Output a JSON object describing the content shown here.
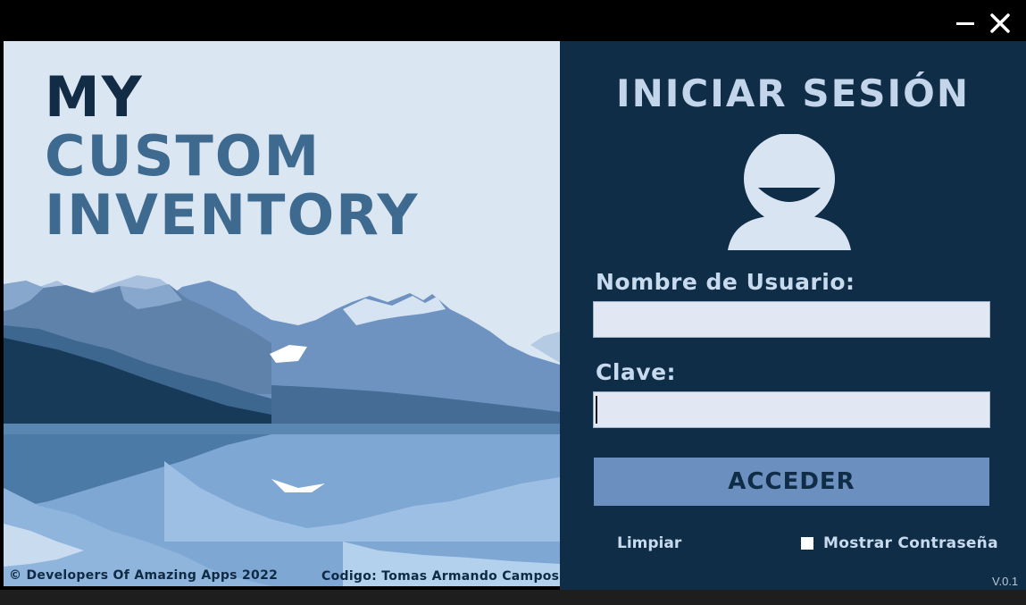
{
  "window": {
    "minimize_icon": "minimize-icon",
    "close_icon": "close-icon"
  },
  "brand": {
    "line1": "MY",
    "line2": "CUSTOM",
    "line3": "INVENTORY"
  },
  "footer": {
    "copyright": "© Developers Of Amazing Apps 2022",
    "credit": "Codigo: Tomas Armando Campos"
  },
  "login": {
    "title": "INICIAR SESIÓN",
    "avatar_icon": "user-avatar-icon",
    "username_label": "Nombre de Usuario:",
    "username_value": "",
    "password_label": "Clave:",
    "password_value": "",
    "submit_label": "ACCEDER",
    "clear_label": "Limpiar",
    "show_password_label": "Mostrar Contraseña",
    "show_password_checked": false,
    "version": "V.0.1"
  },
  "colors": {
    "left_bg": "#dbe6f3",
    "right_bg": "#0f2d46",
    "brand_dark": "#122c45",
    "brand_mid": "#3f6a8f",
    "button_bg": "#6b8fbe",
    "label_text": "#c8daee"
  }
}
